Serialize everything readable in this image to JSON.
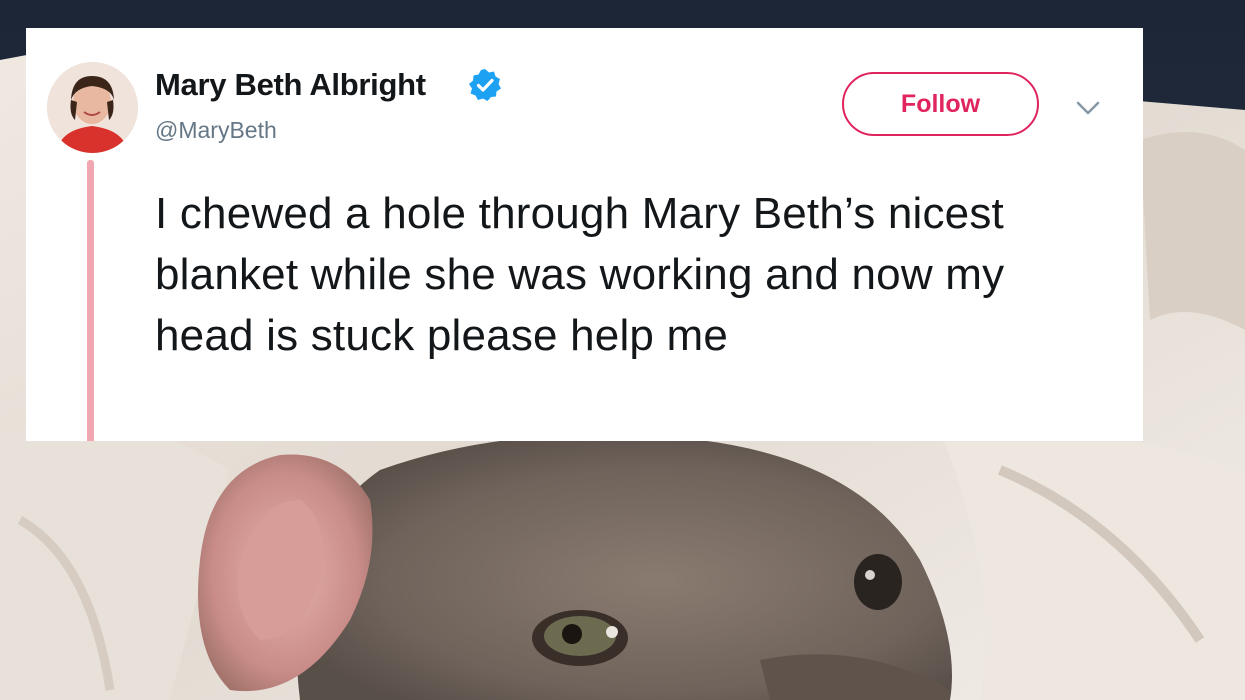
{
  "tweet": {
    "display_name": "Mary Beth Albright",
    "handle": "@MaryBeth",
    "follow_label": "Follow",
    "text": "I chewed a hole through Mary Beth’s nicest blanket while she was working and now my head is stuck please help me",
    "verified": true
  },
  "icons": {
    "verified": "verified-badge-icon",
    "caret": "chevron-down-icon"
  },
  "colors": {
    "follow_accent": "#e0245e",
    "verified_blue": "#1da1f2",
    "thread_line": "#f0a7b0",
    "name_text": "#14171a",
    "handle_text": "#657786"
  }
}
